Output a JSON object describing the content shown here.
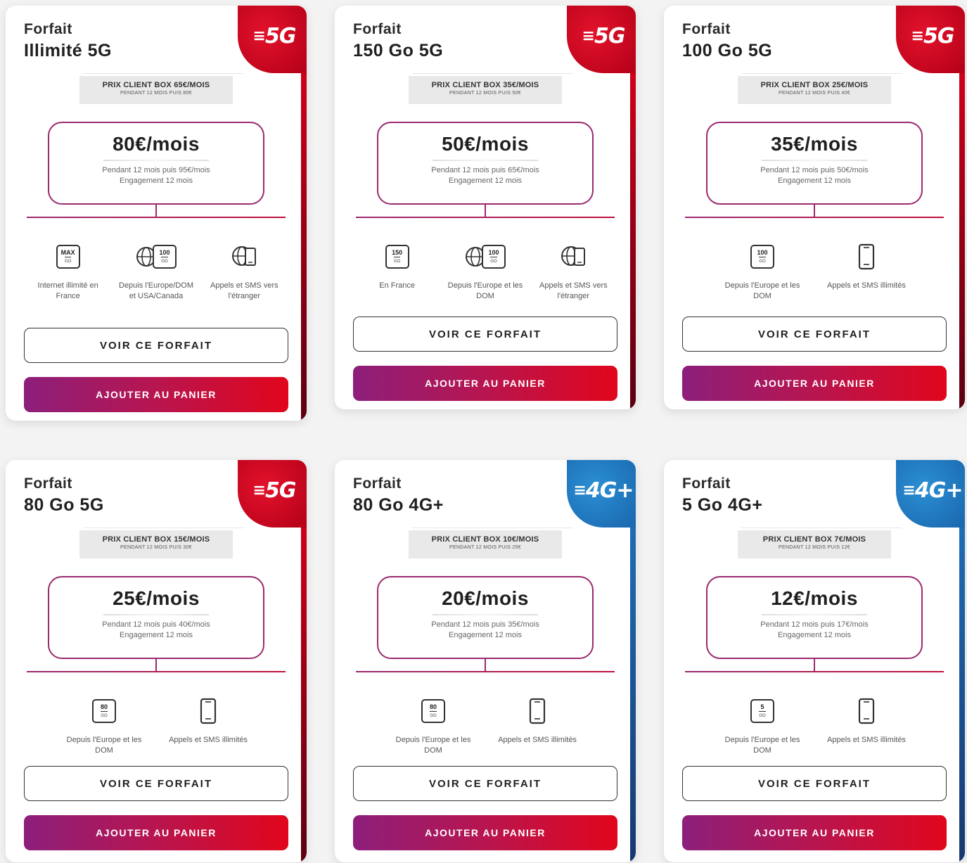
{
  "cards": [
    {
      "title1": "Forfait",
      "title2": "Illimité 5G",
      "network": "5G",
      "promo_line1": "PRIX CLIENT BOX 65€/MOIS",
      "promo_line2": "PENDANT 12 MOIS PUIS 80€",
      "price": "80€/mois",
      "detail1": "Pendant 12 mois puis 95€/mois",
      "detail2": "Engagement 12 mois",
      "features": [
        {
          "icon": "max-data-icon",
          "box_top": "MAX",
          "box_bottom": "GO",
          "label": "Internet illimité en France"
        },
        {
          "icon": "globe-data-icon",
          "box_top": "100",
          "box_bottom": "GO",
          "label": "Depuis l'Europe/DOM et USA/Canada"
        },
        {
          "icon": "globe-phone-icon",
          "label": "Appels et SMS vers l'étranger"
        }
      ],
      "btn_details": "VOIR CE FORFAIT",
      "btn_cart": "AJOUTER AU PANIER"
    },
    {
      "title1": "Forfait",
      "title2": "150 Go 5G",
      "network": "5G",
      "promo_line1": "PRIX CLIENT BOX 35€/MOIS",
      "promo_line2": "PENDANT 12 MOIS PUIS 50€",
      "price": "50€/mois",
      "detail1": "Pendant 12 mois puis 65€/mois",
      "detail2": "Engagement 12 mois",
      "features": [
        {
          "icon": "data-150-icon",
          "box_top": "150",
          "box_bottom": "GO",
          "label": "En France"
        },
        {
          "icon": "globe-data-icon",
          "box_top": "100",
          "box_bottom": "GO",
          "label": "Depuis l'Europe et les DOM"
        },
        {
          "icon": "globe-phone-icon",
          "label": "Appels et SMS vers l'étranger"
        }
      ],
      "btn_details": "VOIR CE FORFAIT",
      "btn_cart": "AJOUTER AU PANIER"
    },
    {
      "title1": "Forfait",
      "title2": "100 Go 5G",
      "network": "5G",
      "promo_line1": "PRIX CLIENT BOX 25€/MOIS",
      "promo_line2": "PENDANT 12 MOIS PUIS 40€",
      "price": "35€/mois",
      "detail1": "Pendant 12 mois puis 50€/mois",
      "detail2": "Engagement 12 mois",
      "features": [
        {
          "icon": "data-100-icon",
          "box_top": "100",
          "box_bottom": "GO",
          "label": "Depuis l'Europe et les DOM"
        },
        {
          "icon": "phone-icon",
          "label": "Appels et SMS illimités"
        }
      ],
      "btn_details": "VOIR CE FORFAIT",
      "btn_cart": "AJOUTER AU PANIER"
    },
    {
      "title1": "Forfait",
      "title2": "80 Go 5G",
      "network": "5G",
      "promo_line1": "PRIX CLIENT BOX 15€/MOIS",
      "promo_line2": "PENDANT 12 MOIS PUIS 30€",
      "price": "25€/mois",
      "detail1": "Pendant 12 mois puis 40€/mois",
      "detail2": "Engagement 12 mois",
      "features": [
        {
          "icon": "data-80-icon",
          "box_top": "80",
          "box_bottom": "GO",
          "label": "Depuis l'Europe et les DOM"
        },
        {
          "icon": "phone-icon",
          "label": "Appels et SMS illimités"
        }
      ],
      "btn_details": "VOIR CE FORFAIT",
      "btn_cart": "AJOUTER AU PANIER"
    },
    {
      "title1": "Forfait",
      "title2": "80 Go 4G+",
      "network": "4G+",
      "promo_line1": "PRIX CLIENT BOX 10€/MOIS",
      "promo_line2": "PENDANT 12 MOIS PUIS 25€",
      "price": "20€/mois",
      "detail1": "Pendant 12 mois puis 35€/mois",
      "detail2": "Engagement 12 mois",
      "features": [
        {
          "icon": "data-80-icon",
          "box_top": "80",
          "box_bottom": "GO",
          "label": "Depuis l'Europe et les DOM"
        },
        {
          "icon": "phone-icon",
          "label": "Appels et SMS illimités"
        }
      ],
      "btn_details": "VOIR CE FORFAIT",
      "btn_cart": "AJOUTER AU PANIER"
    },
    {
      "title1": "Forfait",
      "title2": "5 Go 4G+",
      "network": "4G+",
      "promo_line1": "PRIX CLIENT BOX 7€/MOIS",
      "promo_line2": "PENDANT 12 MOIS PUIS 12€",
      "price": "12€/mois",
      "detail1": "Pendant 12 mois puis 17€/mois",
      "detail2": "Engagement 12 mois",
      "features": [
        {
          "icon": "data-5-icon",
          "box_top": "5",
          "box_bottom": "GO",
          "label": "Depuis l'Europe et les DOM"
        },
        {
          "icon": "phone-icon",
          "label": "Appels et SMS illimités"
        }
      ],
      "btn_details": "VOIR CE FORFAIT",
      "btn_cart": "AJOUTER AU PANIER"
    }
  ],
  "colors": {
    "red_5g": "#d4001a",
    "blue_4g": "#1f6fb8",
    "price_border": "#9b2a6f",
    "cart_gradient_start": "#8c1f7b",
    "cart_gradient_end": "#e1061c"
  }
}
